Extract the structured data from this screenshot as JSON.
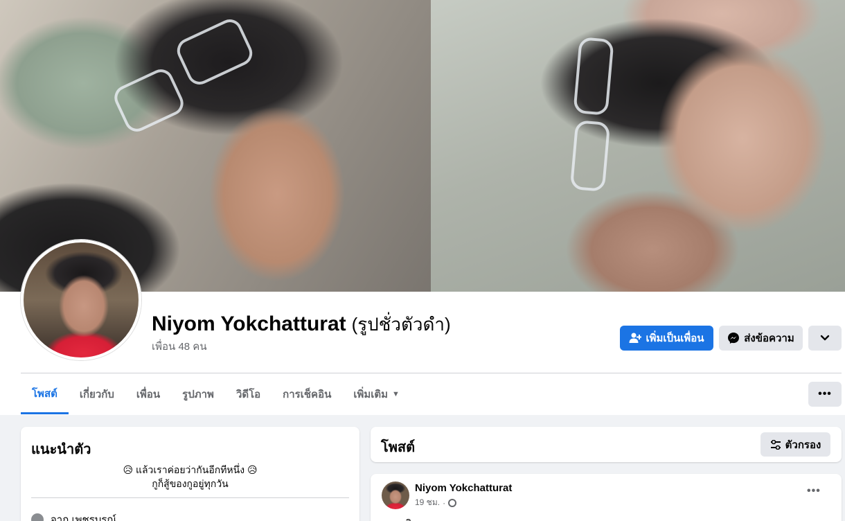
{
  "profile": {
    "name": "Niyom Yokchatturat",
    "alternate_name": "(รูปชั่วตัวดำ)",
    "friends_count": "เพื่อน 48 คน"
  },
  "actions": {
    "add_friend": "เพิ่มเป็นเพื่อน",
    "message": "ส่งข้อความ"
  },
  "tabs": [
    {
      "label": "โพสต์",
      "active": true
    },
    {
      "label": "เกี่ยวกับ"
    },
    {
      "label": "เพื่อน"
    },
    {
      "label": "รูปภาพ"
    },
    {
      "label": "วิดีโอ"
    },
    {
      "label": "การเช็คอิน"
    },
    {
      "label": "เพิ่มเติม"
    }
  ],
  "intro": {
    "title": "แนะนำตัว",
    "bio_line1": "😥 แล้วเราค่อยว่ากันอีกทีหนึ่ง 😥",
    "bio_line2": "กูก็สู้ของกูอยู่ทุกวัน",
    "location": "จาก เพชรบูรณ์"
  },
  "posts": {
    "title": "โพสต์",
    "filter_label": "ตัวกรอง"
  },
  "post": {
    "author": "Niyom Yokchatturat",
    "time": "19 ชม.",
    "text": "ของจริง"
  },
  "colors": {
    "accent": "#1b74e4",
    "background": "#f0f2f5"
  }
}
